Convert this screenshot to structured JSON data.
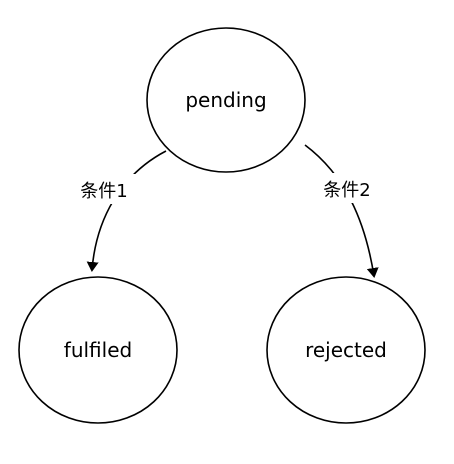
{
  "diagram": {
    "nodes": {
      "pending": "pending",
      "fulfilled": "fulfiled",
      "rejected": "rejected"
    },
    "edges": {
      "to_fulfilled": "条件1",
      "to_rejected": "条件2"
    },
    "colors": {
      "stroke": "#000000",
      "background": "#ffffff"
    }
  }
}
